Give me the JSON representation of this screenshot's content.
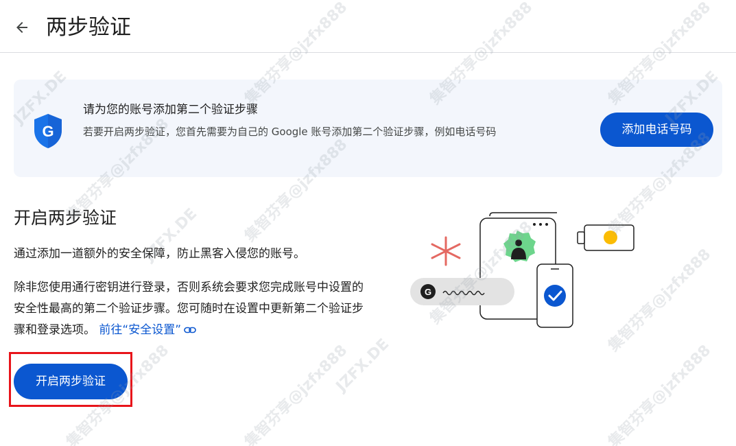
{
  "header": {
    "back_icon": "arrow-back-icon",
    "title": "两步验证"
  },
  "banner": {
    "icon": "google-shield-icon",
    "title": "请为您的账号添加第二个验证步骤",
    "description": "若要开启两步验证，您首先需要为自己的 Google 账号添加第二个验证步骤，例如电话号码",
    "button_label": "添加电话号码"
  },
  "main": {
    "section_title": "开启两步验证",
    "paragraph1": "通过添加一道额外的安全保障，防止黑客入侵您的账号。",
    "paragraph2": "除非您使用通行密钥进行登录，否则系统会要求您完成账号中设置的安全性最高的第二个验证步骤。您可随时在设置中更新第二个验证步骤和登录选项。",
    "security_link": "前往“安全设置”",
    "link_icon": "link-icon",
    "enable_button": "开启两步验证"
  },
  "watermark": {
    "text1": "集智芬享@jzfx888",
    "text2": "JZFX.DE"
  },
  "colors": {
    "primary": "#0b57d0",
    "banner_bg": "#f3f6fc",
    "highlight": "#e8141a",
    "illustration_green": "#6dd58c",
    "illustration_red": "#e46962",
    "illustration_yellow": "#fbbc04"
  }
}
